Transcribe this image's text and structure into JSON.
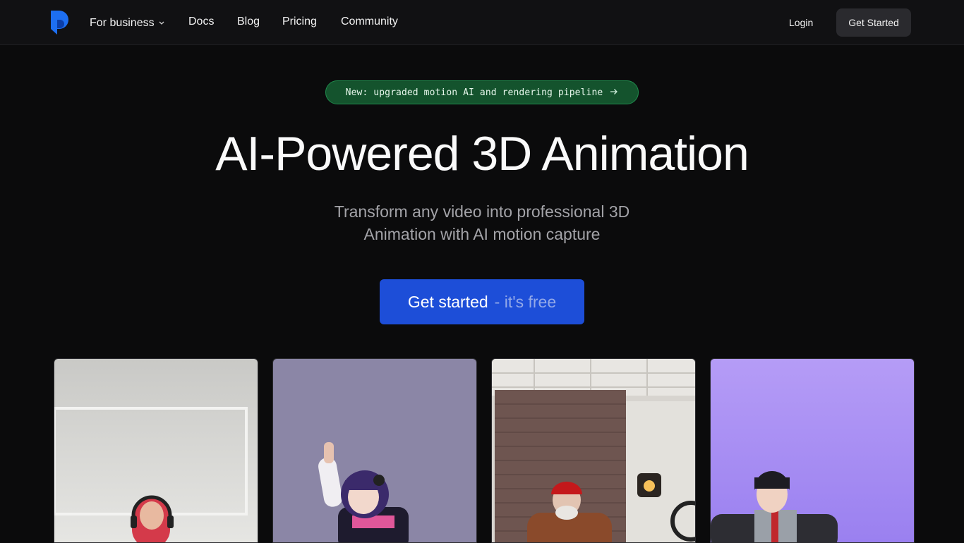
{
  "nav": {
    "links": [
      {
        "label": "For business",
        "has_dropdown": true
      },
      {
        "label": "Docs"
      },
      {
        "label": "Blog"
      },
      {
        "label": "Pricing"
      },
      {
        "label": "Community"
      }
    ],
    "login_label": "Login",
    "get_started_label": "Get Started"
  },
  "badge": {
    "text": "New: upgraded motion AI and rendering pipeline",
    "icon": "arrow-right-icon"
  },
  "hero": {
    "title": "AI-Powered 3D Animation",
    "subtitle": "Transform any video into professional 3D Animation with AI motion capture"
  },
  "cta": {
    "label": "Get started",
    "suffix": "- it's free"
  },
  "colors": {
    "accent": "#1d4ed8",
    "badge_bg": "#14532d",
    "background": "#0b0b0c"
  }
}
